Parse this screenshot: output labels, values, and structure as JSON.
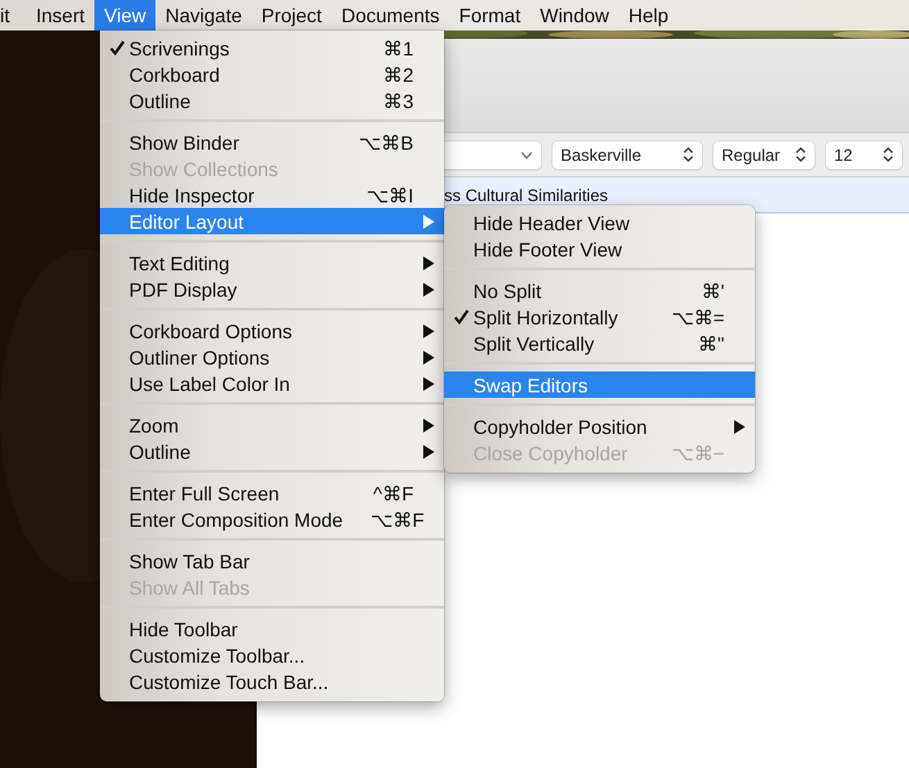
{
  "menubar": [
    {
      "label": "it",
      "selected": false
    },
    {
      "label": "Insert",
      "selected": false
    },
    {
      "label": "View",
      "selected": true
    },
    {
      "label": "Navigate",
      "selected": false
    },
    {
      "label": "Project",
      "selected": false
    },
    {
      "label": "Documents",
      "selected": false
    },
    {
      "label": "Format",
      "selected": false
    },
    {
      "label": "Window",
      "selected": false
    },
    {
      "label": "Help",
      "selected": false
    }
  ],
  "window": {
    "format_bar": [
      {
        "kind": "dropdown"
      },
      {
        "kind": "stepper",
        "value": "Baskerville"
      },
      {
        "kind": "stepper",
        "value": "Regular"
      },
      {
        "kind": "stepper",
        "value": "12"
      }
    ],
    "header": "ss Cultural Similarities"
  },
  "menu": {
    "sections": [
      {
        "items": [
          {
            "label": "Scrivenings",
            "shortcut": "⌘1",
            "checked": true,
            "disabled": false,
            "selected": false,
            "submenu": false
          },
          {
            "label": "Corkboard",
            "shortcut": "⌘2",
            "checked": false,
            "disabled": false,
            "selected": false,
            "submenu": false
          },
          {
            "label": "Outline",
            "shortcut": "⌘3",
            "checked": false,
            "disabled": false,
            "selected": false,
            "submenu": false
          }
        ]
      },
      {
        "items": [
          {
            "label": "Show Binder",
            "shortcut": "⌥⌘B",
            "checked": false,
            "disabled": false,
            "selected": false,
            "submenu": false
          },
          {
            "label": "Show Collections",
            "checked": false,
            "disabled": true,
            "selected": false,
            "submenu": false
          },
          {
            "label": "Hide Inspector",
            "shortcut": "⌥⌘I",
            "checked": false,
            "disabled": false,
            "selected": false,
            "submenu": false
          },
          {
            "label": "Editor Layout",
            "checked": false,
            "disabled": false,
            "selected": true,
            "submenu": true
          }
        ]
      },
      {
        "items": [
          {
            "label": "Text Editing",
            "checked": false,
            "disabled": false,
            "selected": false,
            "submenu": true
          },
          {
            "label": "PDF Display",
            "checked": false,
            "disabled": false,
            "selected": false,
            "submenu": true
          }
        ]
      },
      {
        "items": [
          {
            "label": "Corkboard Options",
            "checked": false,
            "disabled": false,
            "selected": false,
            "submenu": true
          },
          {
            "label": "Outliner Options",
            "checked": false,
            "disabled": false,
            "selected": false,
            "submenu": true
          },
          {
            "label": "Use Label Color In",
            "checked": false,
            "disabled": false,
            "selected": false,
            "submenu": true
          }
        ]
      },
      {
        "items": [
          {
            "label": "Zoom",
            "checked": false,
            "disabled": false,
            "selected": false,
            "submenu": true
          },
          {
            "label": "Outline",
            "checked": false,
            "disabled": false,
            "selected": false,
            "submenu": true
          }
        ]
      },
      {
        "items": [
          {
            "label": "Enter Full Screen",
            "shortcut": "^⌘F",
            "checked": false,
            "disabled": false,
            "selected": false,
            "submenu": false
          },
          {
            "label": "Enter Composition Mode",
            "shortcut": "⌥⌘F",
            "checked": false,
            "disabled": false,
            "selected": false,
            "submenu": false
          }
        ]
      },
      {
        "items": [
          {
            "label": "Show Tab Bar",
            "checked": false,
            "disabled": false,
            "selected": false,
            "submenu": false
          },
          {
            "label": "Show All Tabs",
            "checked": false,
            "disabled": true,
            "selected": false,
            "submenu": false
          }
        ]
      },
      {
        "items": [
          {
            "label": "Hide Toolbar",
            "checked": false,
            "disabled": false,
            "selected": false,
            "submenu": false
          },
          {
            "label": "Customize Toolbar...",
            "checked": false,
            "disabled": false,
            "selected": false,
            "submenu": false
          },
          {
            "label": "Customize Touch Bar...",
            "checked": false,
            "disabled": false,
            "selected": false,
            "submenu": false
          }
        ]
      }
    ]
  },
  "submenu": {
    "sections": [
      {
        "items": [
          {
            "label": "Hide Header View",
            "checked": false,
            "disabled": false,
            "selected": false,
            "submenu": false
          },
          {
            "label": "Hide Footer View",
            "checked": false,
            "disabled": false,
            "selected": false,
            "submenu": false
          }
        ]
      },
      {
        "items": [
          {
            "label": "No Split",
            "shortcut": "⌘'",
            "checked": false,
            "disabled": false,
            "selected": false,
            "submenu": false
          },
          {
            "label": "Split Horizontally",
            "shortcut": "⌥⌘=",
            "checked": true,
            "disabled": false,
            "selected": false,
            "submenu": false
          },
          {
            "label": "Split Vertically",
            "shortcut": "⌘\"",
            "checked": false,
            "disabled": false,
            "selected": false,
            "submenu": false
          }
        ]
      },
      {
        "items": [
          {
            "label": "Swap Editors",
            "checked": false,
            "disabled": false,
            "selected": true,
            "submenu": false
          }
        ]
      },
      {
        "items": [
          {
            "label": "Copyholder Position",
            "checked": false,
            "disabled": false,
            "selected": false,
            "submenu": true
          },
          {
            "label": "Close Copyholder",
            "shortcut": "⌥⌘−",
            "checked": false,
            "disabled": true,
            "selected": false,
            "submenu": false
          }
        ]
      }
    ]
  }
}
